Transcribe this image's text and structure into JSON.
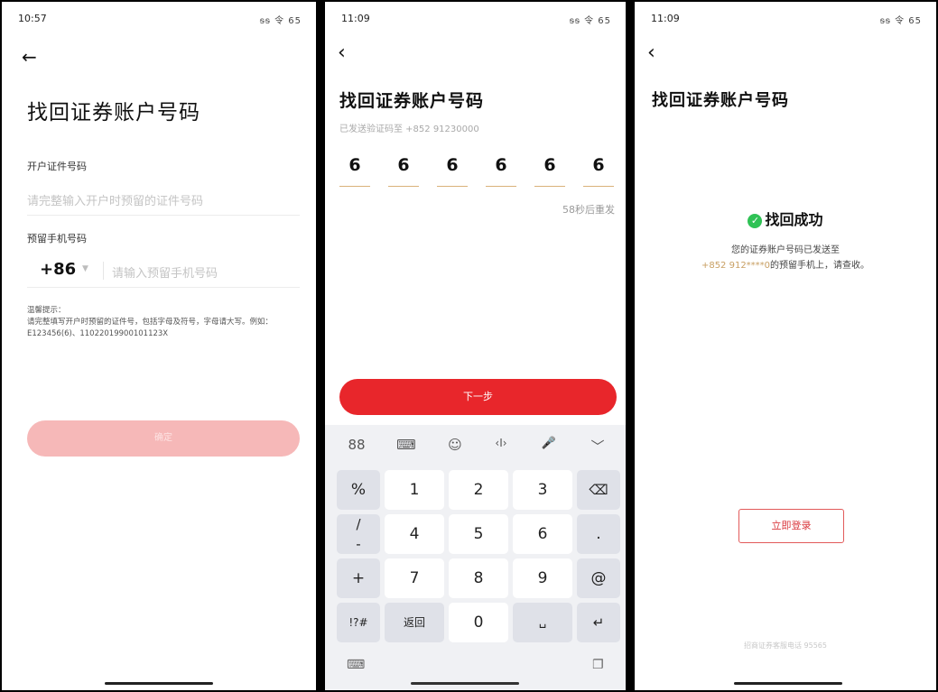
{
  "screen1": {
    "time": "10:57",
    "status_icons": "ᵴᵴ 令 65",
    "title": "找回证券账户号码",
    "id_label": "开户证件号码",
    "id_placeholder": "请完整输入开户时预留的证件号码",
    "phone_label": "预留手机号码",
    "country_code": "+86",
    "phone_placeholder": "请输入预留手机号码",
    "tip_title": "温馨提示：",
    "tip_body": "请完整填写开户时预留的证件号，包括字母及符号，字母请大写。例如：E123456(6)、11022019900101123X",
    "confirm_label": "确定"
  },
  "screen2": {
    "time": "11:09",
    "status_icons": "ᵴᵴ 令 65",
    "title": "找回证券账户号码",
    "sent_to": "已发送验证码至 +852 91230000",
    "code_digits": [
      "6",
      "6",
      "6",
      "6",
      "6",
      "6"
    ],
    "resend": "58秒后重发",
    "next_label": "下一步",
    "keyboard": {
      "toolbar_icons": [
        "88",
        "⌨",
        "☺",
        "‹I›",
        "🎤",
        "﹀"
      ],
      "rows": [
        [
          "%",
          "1",
          "2",
          "3",
          "⌫"
        ],
        [
          "/",
          "4",
          "5",
          "6",
          "."
        ],
        [
          "-",
          "",
          "",
          "",
          ""
        ],
        [
          "+",
          "7",
          "8",
          "9",
          "@"
        ],
        [
          "!?#",
          "返回",
          "0",
          "␣",
          "↵"
        ]
      ],
      "bottom_left_icon": "⌨",
      "bottom_right_icon": "❐"
    }
  },
  "screen3": {
    "time": "11:09",
    "status_icons": "ᵴᵴ 令 65",
    "title": "找回证券账户号码",
    "success_title": "找回成功",
    "msg_line1": "您的证券账户号码已发送至",
    "msg_phone": "+852 912****0",
    "msg_line2_rest": "的预留手机上，请查收。",
    "login_label": "立即登录",
    "hotline": "招商证券客服电话 95565"
  }
}
